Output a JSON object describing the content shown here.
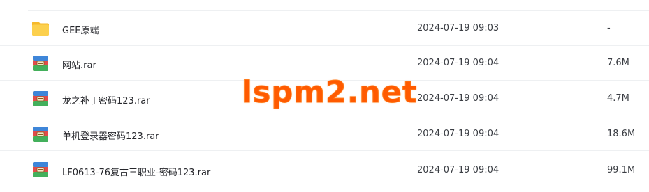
{
  "files": [
    {
      "name": "GEE原端",
      "date": "2024-07-19 09:03",
      "size": "-",
      "icon": "folder-icon"
    },
    {
      "name": "网站.rar",
      "date": "2024-07-19 09:04",
      "size": "7.6M",
      "icon": "rar-archive-icon"
    },
    {
      "name": "龙之补丁密码123.rar",
      "date": "2024-07-19 09:04",
      "size": "4.7M",
      "icon": "rar-archive-icon"
    },
    {
      "name": "单机登录器密码123.rar",
      "date": "2024-07-19 09:04",
      "size": "18.6M",
      "icon": "rar-archive-icon"
    },
    {
      "name": "LF0613-76复古三职业-密码123.rar",
      "date": "2024-07-19 09:04",
      "size": "99.1M",
      "icon": "rar-archive-icon"
    }
  ],
  "watermark": {
    "text": "lspm2.net",
    "color": "#ff5a00"
  },
  "colors": {
    "folder": "#f8c53a",
    "divider": "#eef0f2",
    "text": "#25262b"
  }
}
